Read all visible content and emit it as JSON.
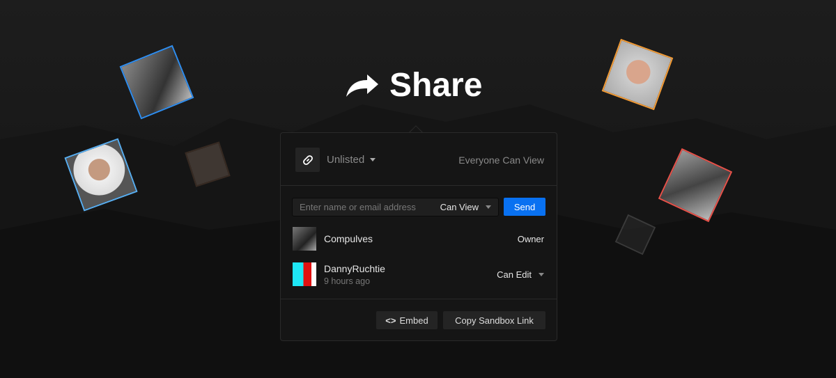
{
  "header": {
    "title": "Share",
    "icon": "share-arrow-icon"
  },
  "panel": {
    "privacy": {
      "icon": "link-icon",
      "value": "Unlisted",
      "summary": "Everyone Can View"
    },
    "invite": {
      "placeholder": "Enter name or email address",
      "permission": "Can View",
      "send_label": "Send"
    },
    "collaborators": [
      {
        "name": "Compulves",
        "role": "Owner",
        "time": ""
      },
      {
        "name": "DannyRuchtie",
        "role": "Can Edit",
        "time": "9 hours ago"
      }
    ],
    "footer": {
      "embed_label": "Embed",
      "copy_label": "Copy Sandbox Link"
    }
  },
  "colors": {
    "accent": "#0971f1",
    "avatar_borders": [
      "#2f8ef0",
      "#59aef0",
      "#5a4030",
      "#f39b35",
      "#e8524a",
      "#555555"
    ]
  }
}
